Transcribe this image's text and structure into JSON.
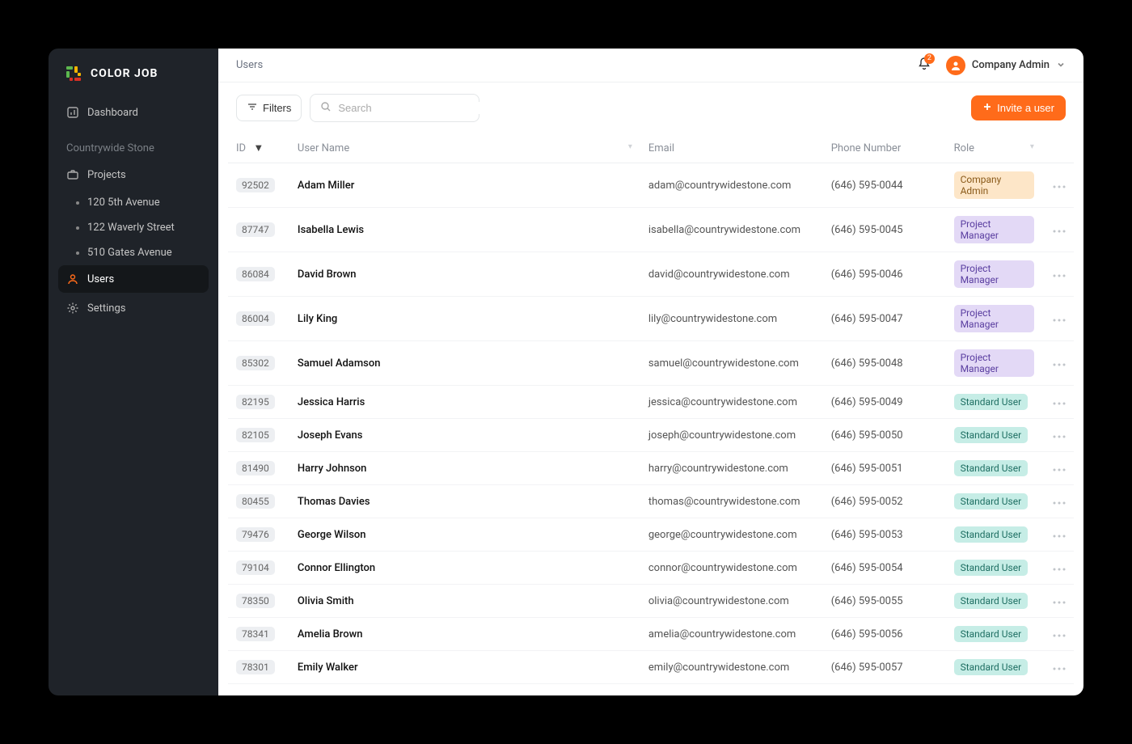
{
  "brand": {
    "name": "COLOR JOB"
  },
  "sidebar": {
    "dashboard": "Dashboard",
    "section": "Countrywide Stone",
    "projects": "Projects",
    "project_items": [
      "120 5th Avenue",
      "122 Waverly Street",
      "510 Gates Avenue"
    ],
    "users": "Users",
    "settings": "Settings"
  },
  "header": {
    "breadcrumb": "Users",
    "notifications_count": "2",
    "user_label": "Company Admin"
  },
  "toolbar": {
    "filters_label": "Filters",
    "search_placeholder": "Search",
    "invite_label": "Invite a user"
  },
  "table": {
    "columns": {
      "id": "ID",
      "name": "User Name",
      "email": "Email",
      "phone": "Phone Number",
      "role": "Role"
    },
    "rows": [
      {
        "id": "92502",
        "name": "Adam Miller",
        "email": "adam@countrywidestone.com",
        "phone": "(646) 595-0044",
        "role": "Company Admin",
        "role_class": "company-admin"
      },
      {
        "id": "87747",
        "name": "Isabella Lewis",
        "email": "isabella@countrywidestone.com",
        "phone": "(646) 595-0045",
        "role": "Project Manager",
        "role_class": "project-manager"
      },
      {
        "id": "86084",
        "name": "David Brown",
        "email": "david@countrywidestone.com",
        "phone": "(646) 595-0046",
        "role": "Project Manager",
        "role_class": "project-manager"
      },
      {
        "id": "86004",
        "name": "Lily King",
        "email": "lily@countrywidestone.com",
        "phone": "(646) 595-0047",
        "role": "Project Manager",
        "role_class": "project-manager"
      },
      {
        "id": "85302",
        "name": "Samuel Adamson",
        "email": "samuel@countrywidestone.com",
        "phone": "(646) 595-0048",
        "role": "Project Manager",
        "role_class": "project-manager"
      },
      {
        "id": "82195",
        "name": "Jessica Harris",
        "email": "jessica@countrywidestone.com",
        "phone": "(646) 595-0049",
        "role": "Standard User",
        "role_class": "standard-user"
      },
      {
        "id": "82105",
        "name": "Joseph Evans",
        "email": "joseph@countrywidestone.com",
        "phone": "(646) 595-0050",
        "role": "Standard User",
        "role_class": "standard-user"
      },
      {
        "id": "81490",
        "name": "Harry Johnson",
        "email": "harry@countrywidestone.com",
        "phone": "(646) 595-0051",
        "role": "Standard User",
        "role_class": "standard-user"
      },
      {
        "id": "80455",
        "name": "Thomas Davies",
        "email": "thomas@countrywidestone.com",
        "phone": "(646) 595-0052",
        "role": "Standard User",
        "role_class": "standard-user"
      },
      {
        "id": "79476",
        "name": "George Wilson",
        "email": "george@countrywidestone.com",
        "phone": "(646) 595-0053",
        "role": "Standard User",
        "role_class": "standard-user"
      },
      {
        "id": "79104",
        "name": "Connor Ellington",
        "email": "connor@countrywidestone.com",
        "phone": "(646) 595-0054",
        "role": "Standard User",
        "role_class": "standard-user"
      },
      {
        "id": "78350",
        "name": "Olivia Smith",
        "email": "olivia@countrywidestone.com",
        "phone": "(646) 595-0055",
        "role": "Standard User",
        "role_class": "standard-user"
      },
      {
        "id": "78341",
        "name": "Amelia Brown",
        "email": "amelia@countrywidestone.com",
        "phone": "(646) 595-0056",
        "role": "Standard User",
        "role_class": "standard-user"
      },
      {
        "id": "78301",
        "name": "Emily Walker",
        "email": "emily@countrywidestone.com",
        "phone": "(646) 595-0057",
        "role": "Standard User",
        "role_class": "standard-user"
      }
    ]
  }
}
